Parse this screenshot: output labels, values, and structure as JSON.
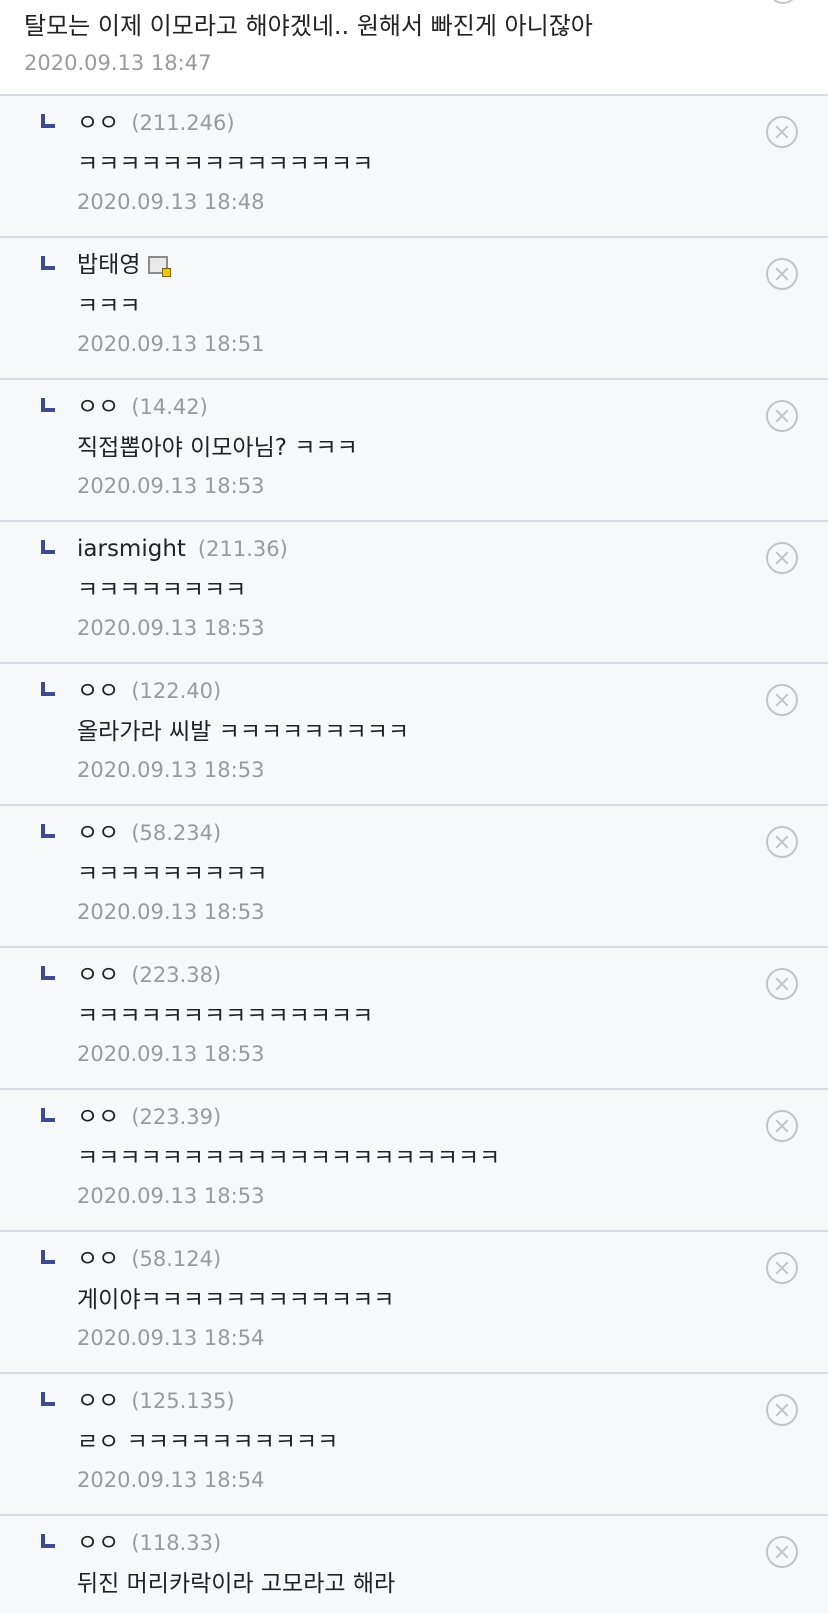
{
  "parent": {
    "text": "탈모는 이제 이모라고 해야겠네.. 원해서 빠진게 아니잖아",
    "date": "2020.09.13 18:47"
  },
  "replies": [
    {
      "nick": "ㅇㅇ",
      "ip": "(211.246)",
      "text": "ㅋㅋㅋㅋㅋㅋㅋㅋㅋㅋㅋㅋㅋㅋ",
      "date": "2020.09.13 18:48"
    },
    {
      "nick": "밥태영",
      "ip": "",
      "badge": "gallery-user-icon",
      "text": "ㅋㅋㅋ",
      "date": "2020.09.13 18:51"
    },
    {
      "nick": "ㅇㅇ",
      "ip": "(14.42)",
      "text": "직접뽑아야 이모아님? ㅋㅋㅋ",
      "date": "2020.09.13 18:53"
    },
    {
      "nick": "iarsmight",
      "ip": "(211.36)",
      "text": "ㅋㅋㅋㅋㅋㅋㅋㅋ",
      "date": "2020.09.13 18:53"
    },
    {
      "nick": "ㅇㅇ",
      "ip": "(122.40)",
      "text": "올라가라 씨발 ㅋㅋㅋㅋㅋㅋㅋㅋㅋ",
      "date": "2020.09.13 18:53"
    },
    {
      "nick": "ㅇㅇ",
      "ip": "(58.234)",
      "text": "ㅋㅋㅋㅋㅋㅋㅋㅋㅋ",
      "date": "2020.09.13 18:53"
    },
    {
      "nick": "ㅇㅇ",
      "ip": "(223.38)",
      "text": "ㅋㅋㅋㅋㅋㅋㅋㅋㅋㅋㅋㅋㅋㅋ",
      "date": "2020.09.13 18:53"
    },
    {
      "nick": "ㅇㅇ",
      "ip": "(223.39)",
      "text": "ㅋㅋㅋㅋㅋㅋㅋㅋㅋㅋㅋㅋㅋㅋㅋㅋㅋㅋㅋㅋ",
      "date": "2020.09.13 18:53"
    },
    {
      "nick": "ㅇㅇ",
      "ip": "(58.124)",
      "text": "게이야ㅋㅋㅋㅋㅋㅋㅋㅋㅋㅋㅋㅋ",
      "date": "2020.09.13 18:54"
    },
    {
      "nick": "ㅇㅇ",
      "ip": "(125.135)",
      "text": "ㄹㅇ ㅋㅋㅋㅋㅋㅋㅋㅋㅋㅋ",
      "date": "2020.09.13 18:54"
    },
    {
      "nick": "ㅇㅇ",
      "ip": "(118.33)",
      "text": "뒤진 머리카락이라 고모라고 해라",
      "date": ""
    }
  ],
  "colors": {
    "reply_background": "#f7f8fa",
    "divider": "#d7dbe3",
    "reply_arrow": "#3c4a8f",
    "meta_text": "#9a9a9a"
  }
}
